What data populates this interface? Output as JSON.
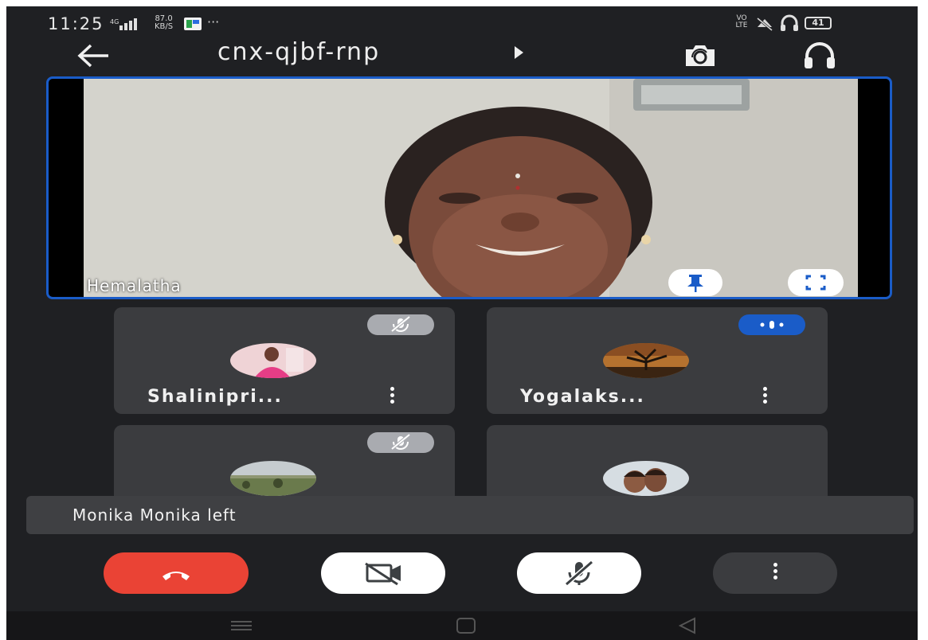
{
  "status_bar": {
    "time": "11:25",
    "network_speed": "87.0",
    "network_speed_unit": "KB/S",
    "overflow": "···",
    "volte_label": "VO LTE",
    "battery": "41",
    "icons": [
      "signal-icon",
      "notification-app-icon",
      "volte-icon",
      "mute-icon",
      "headset-icon",
      "battery-icon"
    ]
  },
  "header": {
    "meeting_code": "cnx-qjbf-rnp",
    "icons": [
      "back-arrow-icon",
      "caret-right-icon",
      "switch-camera-icon",
      "headphones-icon"
    ]
  },
  "main_participant": {
    "name": "Hemalatha",
    "icons": [
      "pin-icon",
      "fullscreen-icon"
    ]
  },
  "participants": [
    {
      "name": "Shalinipri...",
      "muted": true,
      "avatar": "pink-photo-avatar"
    },
    {
      "name": "Yogalaks...",
      "muted": false,
      "speaking": true,
      "avatar": "tree-sunset-avatar"
    },
    {
      "name": "",
      "muted": true,
      "avatar": "landscape-avatar"
    },
    {
      "name": "",
      "muted": false,
      "avatar": "couple-photo-avatar"
    }
  ],
  "toast": {
    "message": "Monika Monika left"
  },
  "controls": {
    "icons": [
      "end-call-icon",
      "camera-off-icon",
      "mic-off-icon",
      "more-vert-icon"
    ]
  },
  "colors": {
    "background": "#1f2023",
    "tile": "#3b3c3f",
    "accent_blue": "#1a5cc8",
    "end_call_red": "#ea4335"
  }
}
